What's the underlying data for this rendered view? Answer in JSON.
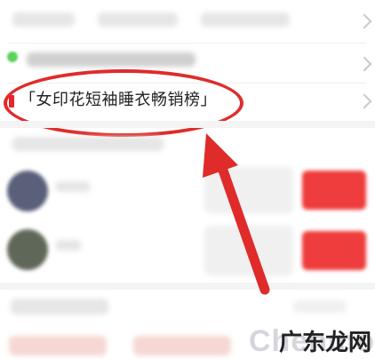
{
  "list": {
    "highlighted_item": "「女印花短袖睡衣畅销榜」"
  },
  "annotation": {
    "color": "#e02b2b"
  },
  "colors": {
    "accent_red": "#ef3c3c",
    "status_green": "#5bd35b"
  },
  "watermark": {
    "text": "广东龙网",
    "back_text": "Chenmo"
  }
}
